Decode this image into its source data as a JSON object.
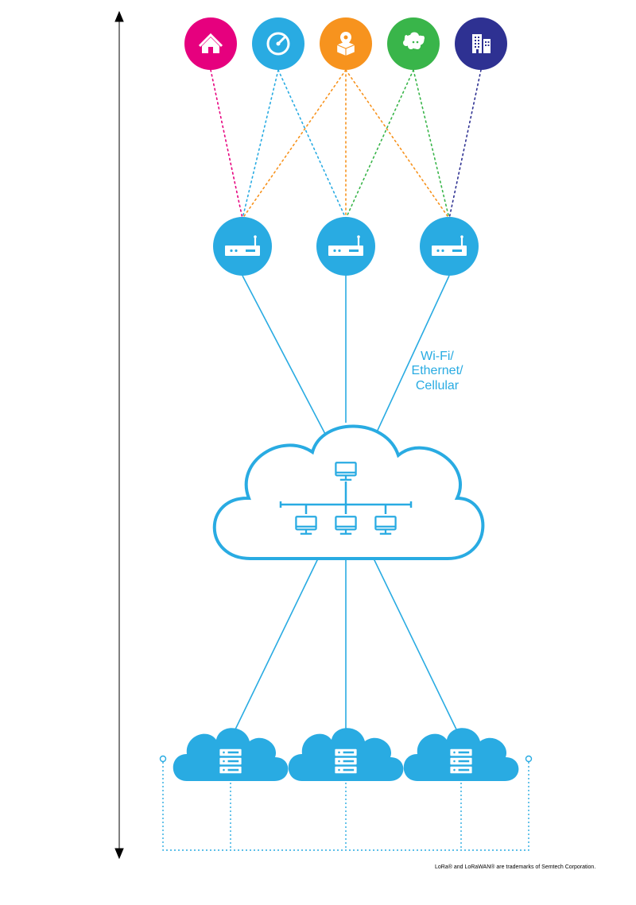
{
  "colors": {
    "blue": "#29abe2",
    "magenta": "#e6007e",
    "orange": "#f7931e",
    "green": "#39b54a",
    "navy": "#2e3192",
    "white": "#ffffff",
    "black": "#000000"
  },
  "diagram": {
    "applications": [
      {
        "name": "home",
        "color": "magenta"
      },
      {
        "name": "speed",
        "color": "blue"
      },
      {
        "name": "package",
        "color": "orange"
      },
      {
        "name": "sheep",
        "color": "green"
      },
      {
        "name": "building",
        "color": "navy"
      }
    ],
    "gateways_count": 3,
    "connection_label": "Wi-Fi/\nEthernet/\nCellular",
    "network_server": "cloud-network",
    "app_servers_count": 3
  },
  "footnote": "LoRa® and LoRaWAN® are trademarks of Semtech Corporation."
}
